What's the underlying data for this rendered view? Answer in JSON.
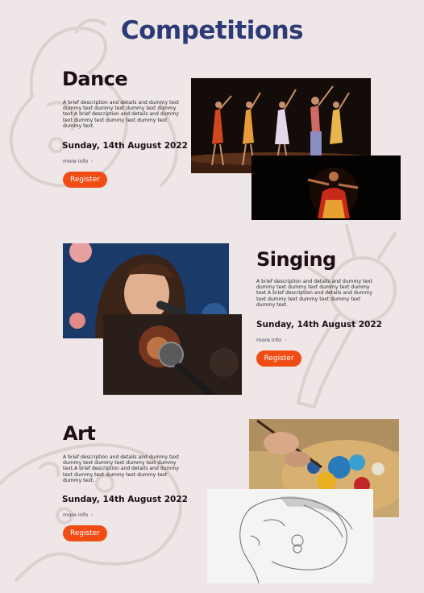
{
  "page": {
    "title": "Competitions"
  },
  "competitions": [
    {
      "name": "Dance",
      "description": "A brief description and details and dummy text dummy text dummy text dummy text dummy text.A brief description and details and dummy text dummy text dummy text dummy text dummy text.",
      "date": "Sunday, 14th August 2022",
      "more_info": "more info",
      "register": "Register"
    },
    {
      "name": "Singing",
      "description": "A brief description and details and dummy text dummy text dummy text dummy text dummy text.A brief description and details and dummy text dummy text dummy text dummy text dummy text.",
      "date": "Sunday, 14th August 2022",
      "more_info": "more info",
      "register": "Register"
    },
    {
      "name": "Art",
      "description": "A brief description and details and dummy text dummy text dummy text dummy text dummy text.A brief description and details and dummy text dummy text dummy text dummy text dummy text.",
      "date": "Sunday, 14th August 2022",
      "more_info": "more info",
      "register": "Register"
    }
  ],
  "icons": {
    "more_info_arrow": "chevron-right-icon"
  },
  "colors": {
    "title": "#2d3a78",
    "accent": "#f04c14",
    "background": "#efe7e7",
    "heading": "#1e0f14"
  }
}
